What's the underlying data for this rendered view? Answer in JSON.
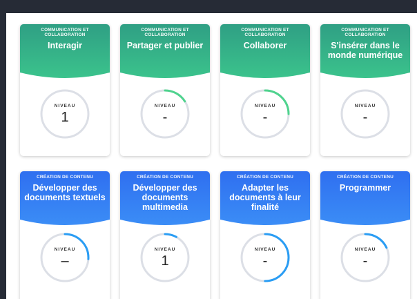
{
  "colors": {
    "green": "#3bb88c",
    "blue": "#3b82f0",
    "green_arc": "#4fd38e",
    "blue_arc": "#2a9df4",
    "track": "#dcdfe6"
  },
  "cards": [
    {
      "category": "COMMUNICATION ET COLLABORATION",
      "title": "Interagir",
      "level_label": "NIVEAU",
      "level": "1",
      "progress": 0.0
    },
    {
      "category": "COMMUNICATION ET COLLABORATION",
      "title": "Partager et publier",
      "level_label": "NIVEAU",
      "level": "-",
      "progress": 0.16
    },
    {
      "category": "COMMUNICATION ET COLLABORATION",
      "title": "Collaborer",
      "level_label": "NIVEAU",
      "level": "-",
      "progress": 0.25
    },
    {
      "category": "COMMUNICATION ET COLLABORATION",
      "title": "S'insérer dans le monde numérique",
      "level_label": "NIVEAU",
      "level": "-",
      "progress": 0.0
    },
    {
      "category": "CRÉATION DE CONTENU",
      "title": "Développer des documents textuels",
      "level_label": "NIVEAU",
      "level": "–",
      "progress": 0.26
    },
    {
      "category": "CRÉATION DE CONTENU",
      "title": "Développer des documents multimedia",
      "level_label": "NIVEAU",
      "level": "1",
      "progress": 0.08
    },
    {
      "category": "CRÉATION DE CONTENU",
      "title": "Adapter les documents à leur finalité",
      "level_label": "NIVEAU",
      "level": "-",
      "progress": 0.5
    },
    {
      "category": "CRÉATION DE CONTENU",
      "title": "Programmer",
      "level_label": "NIVEAU",
      "level": "-",
      "progress": 0.18
    }
  ]
}
